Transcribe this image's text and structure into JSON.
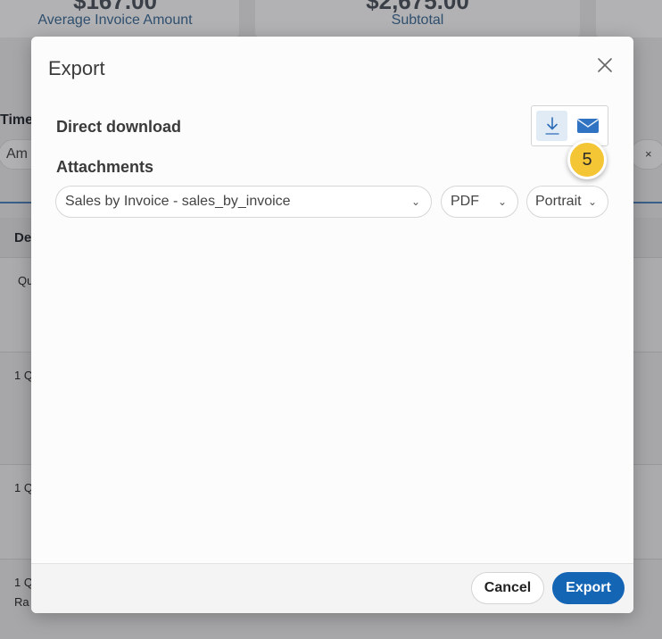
{
  "background": {
    "cards": [
      {
        "value": "$167.00",
        "label": "Average Invoice Amount"
      },
      {
        "value": "$2,675.00",
        "label": "Subtotal"
      }
    ],
    "time_label": "Time",
    "filter_pill_text": "Am",
    "filter_clear": "×",
    "table_header": "De",
    "rows": [
      "Qu",
      "1 Q",
      "1 Q",
      "1 Q"
    ],
    "row_extra": "Ra"
  },
  "modal": {
    "title": "Export",
    "direct_download_label": "Direct download",
    "attachments_label": "Attachments",
    "badge_count": "5",
    "report_select": "Sales by Invoice - sales_by_invoice",
    "format_select": "PDF",
    "orientation_select": "Portrait",
    "cancel_label": "Cancel",
    "export_label": "Export"
  },
  "icons": {
    "close": "close-icon",
    "download": "download-icon",
    "email": "envelope-icon",
    "chevron": "chevron-down-icon"
  },
  "colors": {
    "primary": "#1565b5",
    "badge": "#f4c534",
    "toggle_active": "#e0ebf6"
  }
}
